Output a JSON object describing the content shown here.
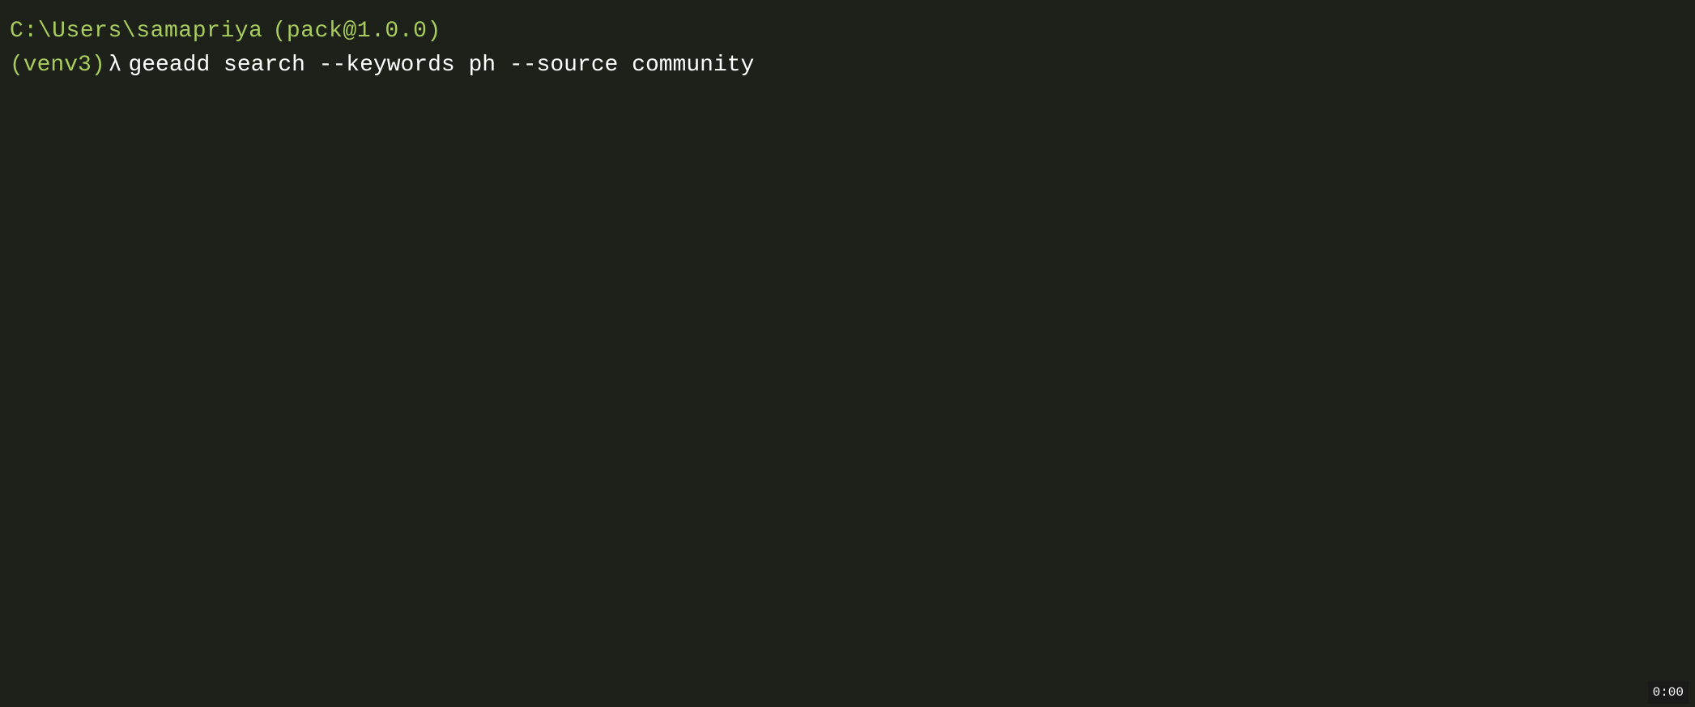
{
  "terminal": {
    "background_color": "#1e2119",
    "line1": {
      "path": "C:\\Users\\samapriya",
      "pack": "(pack@1.0.0)"
    },
    "line2": {
      "prompt_venv": "(venv3)",
      "prompt_lambda": "λ",
      "command": "geeadd search --keywords ph --source community"
    },
    "taskbar": {
      "time": "0:00"
    }
  }
}
